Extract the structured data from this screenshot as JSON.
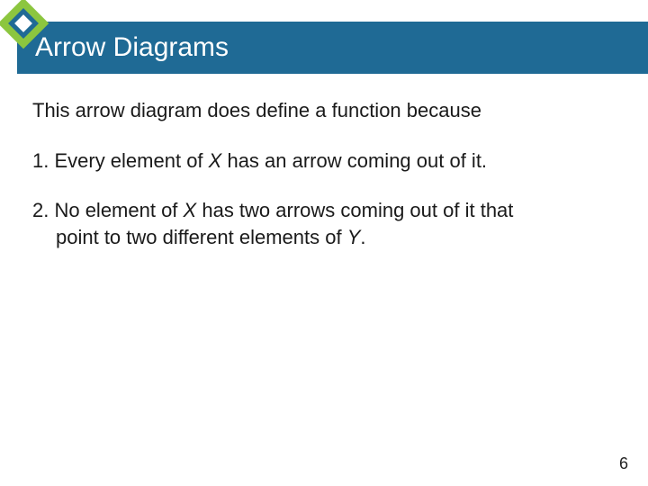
{
  "title": "Arrow Diagrams",
  "intro": "This arrow diagram does define a function because",
  "item1_pre": "1. Every element of ",
  "item1_var": "X",
  "item1_post": " has an arrow coming out of it.",
  "item2_pre": "2. No element of ",
  "item2_var1": "X",
  "item2_mid": " has two arrows coming out of it that",
  "item2_cont_pre": "point to two different elements of ",
  "item2_var2": "Y",
  "item2_cont_post": ".",
  "page_number": "6"
}
